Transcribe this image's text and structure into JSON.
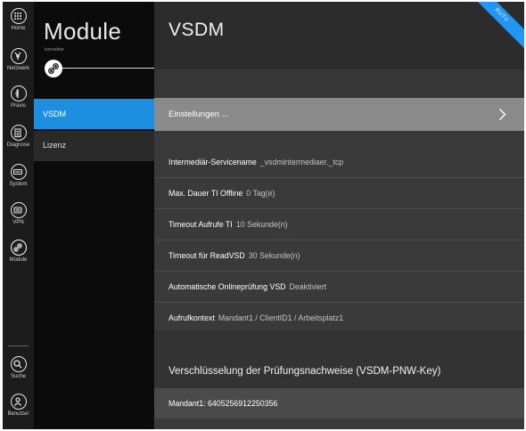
{
  "rail": {
    "items": [
      {
        "label": "Home",
        "icon": "home-grid-icon"
      },
      {
        "label": "Netzwerk",
        "icon": "network-icon"
      },
      {
        "label": "Praxis",
        "icon": "praxis-icon"
      },
      {
        "label": "Diagnose",
        "icon": "diagnose-icon"
      },
      {
        "label": "System",
        "icon": "system-icon"
      },
      {
        "label": "VPN",
        "icon": "vpn-icon"
      },
      {
        "label": "Module",
        "icon": "modules-gears-icon"
      }
    ],
    "bottom": [
      {
        "label": "Suche",
        "icon": "search-icon"
      },
      {
        "label": "Benutzer",
        "icon": "user-icon"
      }
    ]
  },
  "module_panel": {
    "title": "Module",
    "subtitle": "konnektor",
    "nav": [
      {
        "label": "VSDM",
        "active": true
      },
      {
        "label": "Lizenz",
        "active": false
      }
    ]
  },
  "main": {
    "title": "VSDM",
    "ribbon": "RUTU",
    "settings_link": "Einstellungen ...",
    "rows": [
      {
        "key": "Intermediär-Servicename",
        "value": "_vsdmintermediaer._tcp"
      },
      {
        "key": "Max. Dauer TI Offline",
        "value": "0 Tag(e)"
      },
      {
        "key": "Timeout Aufrufe TI",
        "value": "10 Sekunde(n)"
      },
      {
        "key": "Timeout für ReadVSD",
        "value": "30 Sekunde(n)"
      },
      {
        "key": "Automatische Onlineprüfung VSD",
        "value": "Deaktiviert"
      },
      {
        "key": "Aufrufkontext",
        "value": "Mandant1 / ClientID1 / Arbeitsplatz1"
      }
    ],
    "section_title": "Verschlüsselung der Prüfungsnachweise (VSDM-PNW-Key)",
    "key_entry": "Mandant1: 6405256912250356"
  },
  "colors": {
    "accent": "#1e8fe0",
    "rail_bg": "#1c1c1c",
    "panel_bg": "#0b0b0b",
    "main_bg": "#3a3a3a",
    "settings_row_bg": "#8a8a8a"
  }
}
